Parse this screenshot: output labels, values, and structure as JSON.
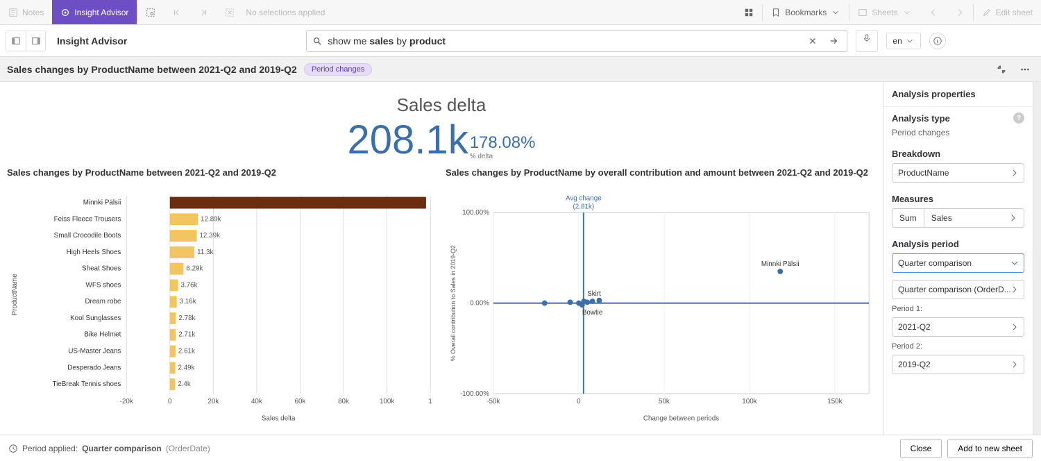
{
  "topbar": {
    "notes": "Notes",
    "insight": "Insight Advisor",
    "noSelections": "No selections applied",
    "bookmarks": "Bookmarks",
    "sheets": "Sheets",
    "edit": "Edit sheet"
  },
  "secbar": {
    "title": "Insight Advisor",
    "search_prefix": "show me ",
    "search_bold1": "sales",
    "search_mid": " by ",
    "search_bold2": "product",
    "lang": "en"
  },
  "subhead": {
    "title": "Sales changes by ProductName between 2021-Q2 and 2019-Q2",
    "pill": "Period changes"
  },
  "kpi": {
    "title": "Sales delta",
    "value": "208.1k",
    "pct": "178.08%",
    "pctLabel": "% delta"
  },
  "barChart": {
    "title": "Sales changes by ProductName between 2021-Q2 and 2019-Q2",
    "ylabel": "ProductName",
    "xlabel": "Sales delta"
  },
  "scatterChart": {
    "title": "Sales changes by ProductName by overall contribution and amount between 2021-Q2 and 2019-Q2",
    "avg1": "Avg change",
    "avg2": "(2.81k)",
    "ylabel": "% Overall contribution to Sales in 2019-Q2",
    "xlabel": "Change between periods",
    "outlier": "Minnki Pälsii",
    "label_skirt": "Skirt",
    "label_bowtie": "Bowtie"
  },
  "props": {
    "title": "Analysis properties",
    "typeHead": "Analysis type",
    "typeVal": "Period changes",
    "breakdownHead": "Breakdown",
    "breakdownVal": "ProductName",
    "measuresHead": "Measures",
    "measSum": "Sum",
    "measVal": "Sales",
    "periodHead": "Analysis period",
    "periodSel": "Quarter comparison",
    "periodDetail": "Quarter comparison (OrderD...",
    "p1label": "Period 1:",
    "p1val": "2021-Q2",
    "p2label": "Period 2:",
    "p2val": "2019-Q2"
  },
  "footer": {
    "applied": "Period applied:",
    "comp": "Quarter comparison",
    "field": "(OrderDate)",
    "close": "Close",
    "add": "Add to new sheet"
  },
  "chart_data": [
    {
      "type": "bar",
      "orientation": "horizontal",
      "title": "Sales changes by ProductName between 2021-Q2 and 2019-Q2",
      "xlabel": "Sales delta",
      "ylabel": "ProductName",
      "xlim": [
        -20000,
        120000
      ],
      "xticks": [
        -20000,
        0,
        20000,
        40000,
        60000,
        80000,
        100000,
        120000
      ],
      "xtick_labels": [
        "-20k",
        "0",
        "20k",
        "40k",
        "60k",
        "80k",
        "100k",
        "1"
      ],
      "categories": [
        "Minnki Pälsii",
        "Feiss Fleece Trousers",
        "Small Crocodile Boots",
        "High Heels Shoes",
        "Sheat Shoes",
        "WFS shoes",
        "Dream robe",
        "Kool Sunglasses",
        "Bike Helmet",
        "US-Master Jeans",
        "Desperado Jeans",
        "TieBreak Tennis shoes"
      ],
      "values": [
        118000,
        12890,
        12390,
        11300,
        6290,
        3760,
        3160,
        2780,
        2710,
        2610,
        2490,
        2400
      ],
      "value_labels": [
        "",
        "12.89k",
        "12.39k",
        "11.3k",
        "6.29k",
        "3.76k",
        "3.16k",
        "2.78k",
        "2.71k",
        "2.61k",
        "2.49k",
        "2.4k"
      ],
      "highlight_index": 0
    },
    {
      "type": "scatter",
      "title": "Sales changes by ProductName by overall contribution and amount between 2021-Q2 and 2019-Q2",
      "xlabel": "Change between periods",
      "ylabel": "% Overall contribution to Sales in 2019-Q2",
      "xlim": [
        -50000,
        170000
      ],
      "xticks": [
        -50000,
        0,
        50000,
        100000,
        150000
      ],
      "xtick_labels": [
        "-50k",
        "0",
        "50k",
        "100k",
        "150k"
      ],
      "ylim": [
        -100,
        100
      ],
      "yticks": [
        -100,
        0,
        100
      ],
      "ytick_labels": [
        "-100.00%",
        "0.00%",
        "100.00%"
      ],
      "ref_lines": {
        "x": 2810,
        "y": 0,
        "xlabel": "Avg change (2.81k)"
      },
      "points": [
        {
          "name": "Minnki Pälsii",
          "x": 118000,
          "y": 35
        },
        {
          "name": "Skirt",
          "x": 3000,
          "y": 2
        },
        {
          "name": "Bowtie",
          "x": 2000,
          "y": -2
        },
        {
          "name": "",
          "x": -20000,
          "y": 0
        },
        {
          "name": "",
          "x": -5000,
          "y": 1
        },
        {
          "name": "",
          "x": 0,
          "y": 0
        },
        {
          "name": "",
          "x": 5000,
          "y": 1
        },
        {
          "name": "",
          "x": 8000,
          "y": 2
        },
        {
          "name": "",
          "x": 12000,
          "y": 3
        }
      ]
    }
  ]
}
